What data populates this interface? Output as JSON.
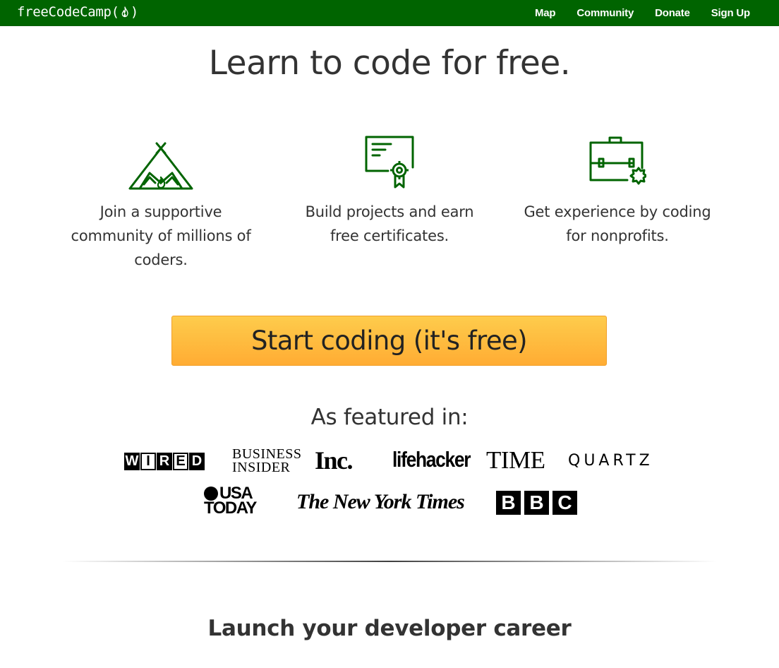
{
  "navbar": {
    "brand": "freeCodeCamp",
    "brand_suffix_open": "(",
    "brand_suffix_close": ")",
    "links": [
      "Map",
      "Community",
      "Donate",
      "Sign Up"
    ],
    "background_color": "#006400"
  },
  "hero": {
    "headline": "Learn to code for free."
  },
  "features": [
    {
      "icon": "campfire-tent-icon",
      "caption": "Join a supportive community of millions of coders."
    },
    {
      "icon": "certificate-icon",
      "caption": "Build projects and earn free certificates."
    },
    {
      "icon": "briefcase-icon",
      "caption": "Get experience by coding for nonprofits."
    }
  ],
  "cta": {
    "label": "Start coding (it's free)",
    "color": "#ffac33"
  },
  "featured": {
    "title": "As featured in:",
    "logos": {
      "wired": [
        "W",
        "I",
        "R",
        "E",
        "D"
      ],
      "business_insider_1": "BUSINESS",
      "business_insider_2": "INSIDER",
      "inc": "Inc.",
      "lifehacker": "lifehacker",
      "time": "TIME",
      "quartz": "QUARTZ",
      "usa_today_1": "USA",
      "usa_today_2": "TODAY",
      "nyt": "The New York Times",
      "bbc": [
        "B",
        "B",
        "C"
      ]
    }
  },
  "career": {
    "title": "Launch your developer career"
  },
  "icon_color": "#006400"
}
